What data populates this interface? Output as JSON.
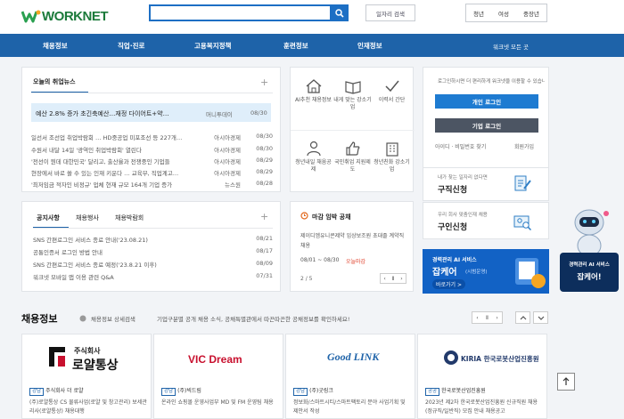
{
  "header": {
    "logo_text": "WORKNET",
    "search_placeholder": "",
    "job_search_label": "일자리 검색",
    "user_types": [
      "청년",
      "여성",
      "중장년"
    ]
  },
  "gnb": {
    "items": [
      "채용정보",
      "직업·진로",
      "고용복지정책",
      "훈련정보",
      "인재정보"
    ],
    "all_menu": "워크넷 모든 곳"
  },
  "news": {
    "tab": "오늘의 취업뉴스",
    "featured": {
      "title": "예산 2.8% 증가 초긴축예산…재정 다이어트+약…",
      "source": "머니투데이",
      "date": "08/30"
    },
    "rows": [
      {
        "title": "일선서 조선업 취업박람회 … HD중공업 미포조선 등 227개…",
        "source": "아시아경제",
        "date": "08/30"
      },
      {
        "title": "수원서 내달 14일 '광역인 취업박람회' 열린다",
        "source": "아시아경제",
        "date": "08/30"
      },
      {
        "title": "'전선이 뭔데 대한민국' 달리고, 출산율과 전쟁중인 기업들",
        "source": "아시아경제",
        "date": "08/29"
      },
      {
        "title": "현장에서 바로 쓸 수 있는 인재 키운다 … 교육부, 직업계고…",
        "source": "아시아경제",
        "date": "08/29"
      },
      {
        "title": "'최저임금 적자인 비정규' 업체 현재 규모 164개 기업 증가",
        "source": "뉴스원",
        "date": "08/28"
      }
    ]
  },
  "quick": {
    "items": [
      "AI추천 채용정보",
      "내게 맞는 강소기업",
      "이력서 간단",
      "청년내일 채움공제",
      "국민취업 지원제도",
      "청년친화 강소기업"
    ]
  },
  "login": {
    "notice": "로그인하시면 더 편리하게 워크넷을 이용할 수 있습니다.",
    "personal_login": "개인 로그인",
    "corporate_login": "기업 로그인",
    "find_idpw": "아이디 · 비밀번호 찾기",
    "join": "회원가입",
    "promo1_small": "내가 찾는 일자리 없다면",
    "promo1_big": "구직신청",
    "promo2_small": "우리 회사 맞춤인재 채용",
    "promo2_big": "구인신청"
  },
  "notice": {
    "tabs": [
      "공지사항",
      "채용행사",
      "채용박람회"
    ],
    "rows": [
      {
        "title": "SNS 간편로그인 서비스 종료 안내('23.08.21)",
        "date": "08/21"
      },
      {
        "title": "공통인증서 로그인 방법 안내",
        "date": "08/17"
      },
      {
        "title": "SNS 간편로그인 서비스 종료 예정('23.8.21 이후)",
        "date": "08/09"
      },
      {
        "title": "워크넷 모바일 앱 이용 관련 Q&A",
        "date": "07/31"
      }
    ]
  },
  "deadline": {
    "title": "마감 임박 공채",
    "company": "제이디엠유니콘제약 임상보조원 초대졸 계약직 채용",
    "period": "08/01 ~ 08/30",
    "status": "오늘마감",
    "page": "2 / 5"
  },
  "banner": {
    "line1": "경력관리 AI 서비스",
    "line2": "잡케어",
    "tag": "(시범운영)",
    "button": "바로가기 >"
  },
  "side_robot": {
    "line1": "경력관리 AI 서비스",
    "line2": "잡케어!"
  },
  "recruit": {
    "title": "채용정보",
    "detail_link": "채용정보 상세검색",
    "notice": "기업구분별 공개 채용 소식, 공채특별관에서 따끈따끈한 공채정보를 확인하세요!",
    "cards": [
      {
        "logo_top": "주식회사",
        "logo_main": "로얄통상",
        "tag": "강남",
        "company": "주식회사 더 로얄",
        "desc": "(주)로얄통상 CS 물류사업(로얄 및 창고관리) 보세관리사(로얄통상) 채용대행",
        "color": "#222222"
      },
      {
        "logo_main": "VIC Dream",
        "tag": "강남",
        "company": "(주)빅드림",
        "desc": "온라인 쇼핑몰 운영사업부 MD 및 FM 운영팀 채용",
        "color": "#c8102e"
      },
      {
        "logo_main": "Good LINK",
        "tag": "강남",
        "company": "(주)굿링크",
        "desc": "정보화/스마트시티/스마트팩토리 분야 사업기획 및 제안서 작성",
        "color": "#1e63a9"
      },
      {
        "logo_main": "KIRIA 한국로봇산업진흥원",
        "tag": "공공",
        "company": "한국로봇산업진흥원",
        "desc": "2023년 제2차 한국로봇산업진흥원 신규직원 채용 (정규직/일반직) 모집 안내 채용공고",
        "color": "#223a6b"
      }
    ],
    "page": "1 / 5"
  }
}
